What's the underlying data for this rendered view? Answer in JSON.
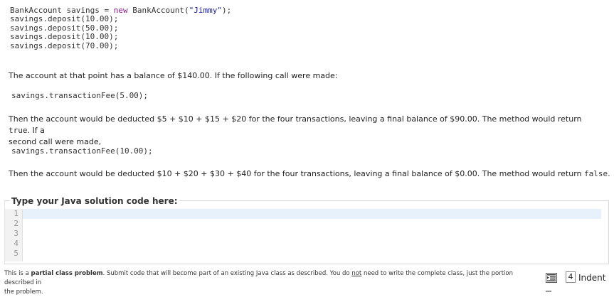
{
  "example_code": {
    "line1_a": "BankAccount savings = ",
    "line1_kw": "new",
    "line1_b": " BankAccount(",
    "line1_str": "\"Jimmy\"",
    "line1_c": ");",
    "deposits": [
      "savings.deposit(10.00);",
      "savings.deposit(50.00);",
      "savings.deposit(10.00);",
      "savings.deposit(70.00);"
    ]
  },
  "para1": "The account at that point has a balance of $140.00. If the following call were made:",
  "call1": "savings.transactionFee(5.00);",
  "para2_a": "Then the account would be deducted $5 + $10 + $15 + $20 for the four transactions, leaving a final balance of $90.00. The method would return ",
  "para2_code": "true",
  "para2_b": ". If a",
  "para2_c": "second call were made,",
  "call2": "savings.transactionFee(10.00);",
  "para3_a": "Then the account would be deducted $10 + $20 + $30 + $40 for the four transactions, leaving a final balance of $0.00. The method would return ",
  "para3_code": "false",
  "para3_b": ".",
  "editor": {
    "label": "Type your Java solution code here:",
    "line_numbers": [
      "1",
      "2",
      "3",
      "4",
      "5"
    ]
  },
  "footer": {
    "a": "This is a ",
    "bold": "partial class problem",
    "b": ". Submit code that will become part of an existing Java class as described. You do ",
    "u": "not",
    "c": " need to write the complete class, just the portion described in",
    "d": "the problem."
  },
  "indent": {
    "icon": "indent-icon",
    "value": "4",
    "label": "Indent"
  }
}
